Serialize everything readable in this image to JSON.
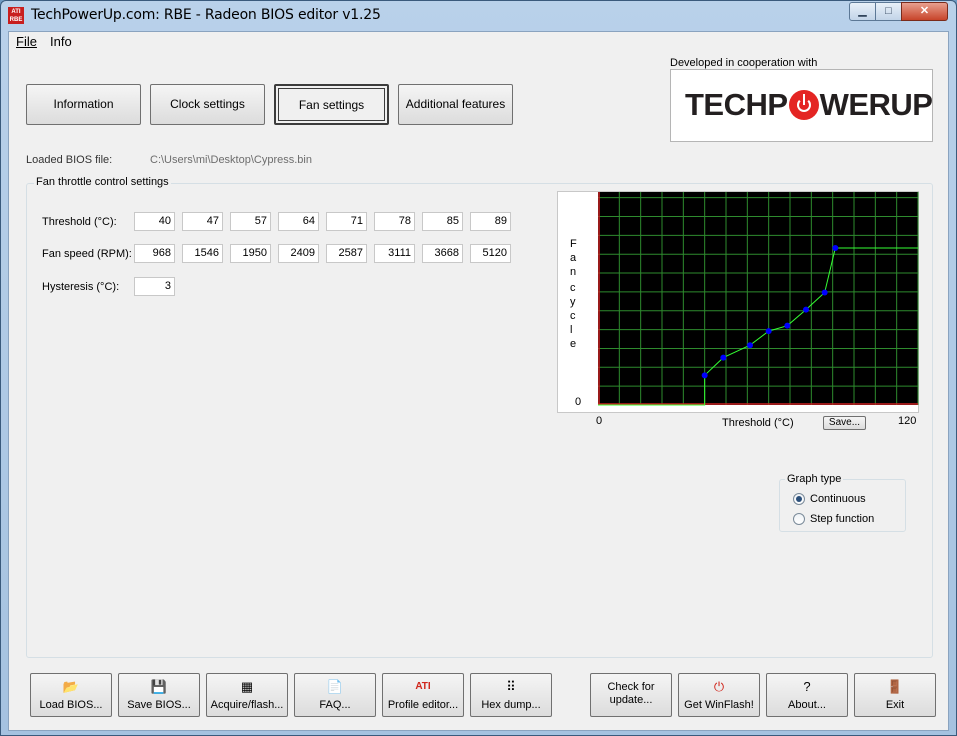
{
  "window": {
    "title": "TechPowerUp.com: RBE - Radeon BIOS editor v1.25",
    "app_icon": "ATI RBE",
    "caption": {
      "min": "▁",
      "max": "□",
      "close": "✕"
    }
  },
  "menu": {
    "file": "File",
    "info": "Info"
  },
  "tabs": [
    {
      "label": "Information"
    },
    {
      "label": "Clock settings"
    },
    {
      "label": "Fan settings",
      "active": true
    },
    {
      "label": "Additional features"
    }
  ],
  "cooperation": {
    "label": "Developed in cooperation with",
    "logo_part1": "TECHP",
    "logo_part2": "WERUP"
  },
  "bios": {
    "label": "Loaded BIOS file:",
    "path": "C:\\Users\\mi\\Desktop\\Cypress.bin"
  },
  "fan_group": {
    "title": "Fan throttle control settings",
    "threshold_label": "Threshold (°C):",
    "fan_speed_label": "Fan speed (RPM):",
    "hysteresis_label": "Hysteresis (°C):",
    "thresholds": [
      "40",
      "47",
      "57",
      "64",
      "71",
      "78",
      "85",
      "89"
    ],
    "fan_speeds": [
      "968",
      "1546",
      "1950",
      "2409",
      "2587",
      "3111",
      "3668",
      "5120"
    ],
    "hysteresis": "3"
  },
  "graph": {
    "y_label_letters": [
      "F",
      "a",
      "n",
      "",
      "c",
      "y",
      "c",
      "l",
      "e"
    ],
    "y_zero": "0",
    "x_min": "0",
    "x_max": "120",
    "x_label": "Threshold (°C)",
    "save_label": "Save..."
  },
  "chart_data": {
    "type": "line",
    "x": [
      40,
      47,
      57,
      64,
      71,
      78,
      85,
      89
    ],
    "values": [
      968,
      1546,
      1950,
      2409,
      2587,
      3111,
      3668,
      5120
    ],
    "xlim": [
      0,
      120
    ],
    "ylim": [
      0,
      5120
    ],
    "xlabel": "Threshold (°C)",
    "ylabel": "Fan cycle",
    "grid": true,
    "colors": {
      "background": "#000000",
      "grid": "#2e8b2e",
      "axis": "#cc2222",
      "line": "#33ff33",
      "point": "#0000ff"
    }
  },
  "graph_type": {
    "title": "Graph type",
    "options": [
      "Continuous",
      "Step function"
    ],
    "selected": "Continuous"
  },
  "bottom_buttons": [
    {
      "label": "Load BIOS...",
      "icon": "📂"
    },
    {
      "label": "Save BIOS...",
      "icon": "💾"
    },
    {
      "label": "Acquire/flash...",
      "icon": "▦"
    },
    {
      "label": "FAQ...",
      "icon": "📄"
    },
    {
      "label": "Profile editor...",
      "icon": "ATI"
    },
    {
      "label": "Hex dump...",
      "icon": "⠿"
    },
    {
      "label": "Check for update...",
      "icon": ""
    },
    {
      "label": "Get WinFlash!",
      "icon": "⏻"
    },
    {
      "label": "About...",
      "icon": "?"
    },
    {
      "label": "Exit",
      "icon": "🚪"
    }
  ]
}
